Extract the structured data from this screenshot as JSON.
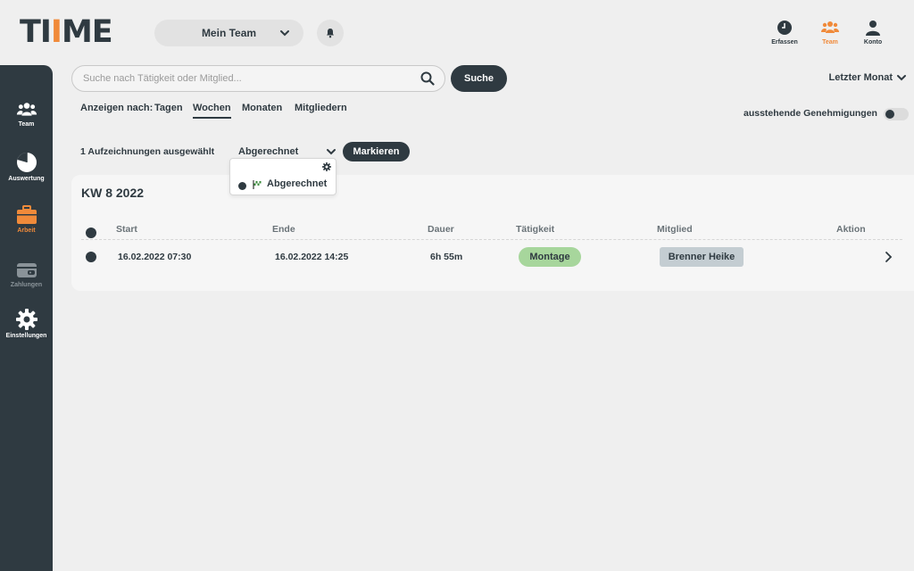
{
  "app": {
    "logo_text_1": "TI",
    "logo_text_2": "I",
    "logo_text_3": "ME"
  },
  "header": {
    "team_select_value": "Mein Team",
    "nav": [
      {
        "label": "Erfassen",
        "icon": "clock-icon"
      },
      {
        "label": "Team",
        "icon": "team-icon"
      },
      {
        "label": "Konto",
        "icon": "user-icon"
      }
    ]
  },
  "sidebar": {
    "items": [
      {
        "label": "Team",
        "icon": "team-icon"
      },
      {
        "label": "Auswertung",
        "icon": "pie-chart-icon"
      },
      {
        "label": "Arbeit",
        "icon": "briefcase-icon"
      },
      {
        "label": "Zahlungen",
        "icon": "wallet-icon"
      },
      {
        "label": "Einstellungen",
        "icon": "gear-icon"
      }
    ]
  },
  "search": {
    "placeholder": "Suche nach Tätigkeit oder Mitglied...",
    "button_label": "Suche"
  },
  "period_select": "Letzter Monat",
  "filter": {
    "label": "Anzeigen nach:",
    "tabs": [
      "Tagen",
      "Wochen",
      "Monaten",
      "Mitgliedern"
    ],
    "active_tab": "Wochen"
  },
  "pending_label": "ausstehende Genehmigungen",
  "selection": {
    "count_text": "1 Aufzeichnungen ausgewählt",
    "status_value": "Abgerechnet",
    "mark_button": "Markieren"
  },
  "dropdown": {
    "option_label": "Abgerechnet"
  },
  "card": {
    "title": "KW 8 2022",
    "columns": [
      "Start",
      "Ende",
      "Dauer",
      "Tätigkeit",
      "Mitglied",
      "Aktion"
    ],
    "rows": [
      {
        "start": "16.02.2022 07:30",
        "end": "16.02.2022 14:25",
        "duration": "6h 55m",
        "activity": "Montage",
        "member": "Brenner Heike"
      }
    ]
  },
  "colors": {
    "dark": "#2f3a41",
    "accent": "#f08a3a",
    "activity_green": "#a7d69c",
    "member_gray": "#c4cdd2"
  }
}
